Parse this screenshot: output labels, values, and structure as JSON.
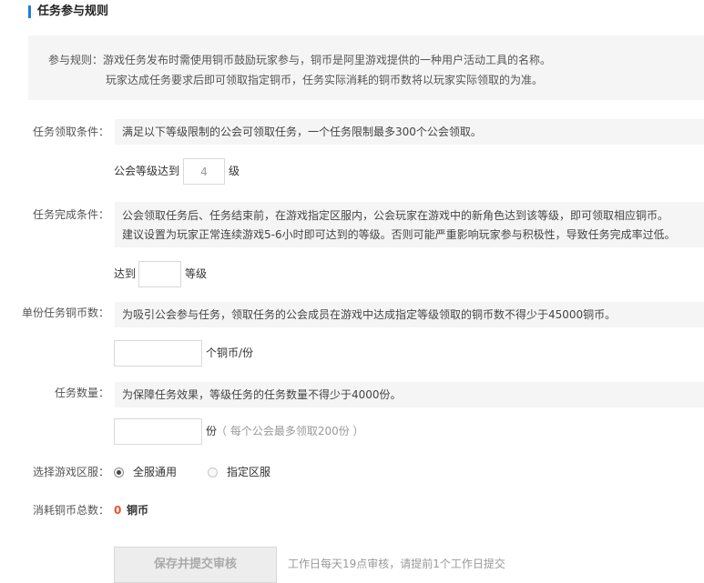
{
  "header": {
    "title": "任务参与规则"
  },
  "rules": {
    "label": "参与规则：",
    "line1": "游戏任务发布时需使用铜币鼓励玩家参与，铜币是阿里游戏提供的一种用户活动工具的名称。",
    "line2": "玩家达成任务要求后即可领取指定铜币，任务实际消耗的铜币数将以玩家实际领取的为准。"
  },
  "claim_condition": {
    "label": "任务领取条件：",
    "hint": "满足以下等级限制的公会可领取任务，一个任务限制最多300个公会领取。",
    "prefix": "公会等级达到",
    "value": "4",
    "suffix": "级"
  },
  "complete_condition": {
    "label": "任务完成条件：",
    "hint_line1": "公会领取任务后、任务结束前，在游戏指定区服内，公会玩家在游戏中的新角色达到该等级，即可领取相应铜币。",
    "hint_line2": "建议设置为玩家正常连续游戏5-6小时即可达到的等级。否则可能严重影响玩家参与积极性，导致任务完成率过低。",
    "prefix": "达到",
    "value": "",
    "suffix": "等级"
  },
  "coins_per_task": {
    "label": "单份任务铜币数：",
    "hint": "为吸引公会参与任务，领取任务的公会成员在游戏中达成指定等级领取的铜币数不得少于45000铜币。",
    "value": "",
    "suffix": "个铜币/份"
  },
  "task_count": {
    "label": "任务数量：",
    "hint": "为保障任务效果，等级任务的任务数量不得少于4000份。",
    "value": "",
    "suffix": "份",
    "note": "（ 每个公会最多领取200份 ）"
  },
  "server": {
    "label": "选择游戏区服：",
    "options": [
      {
        "label": "全服通用",
        "selected": true
      },
      {
        "label": "指定区服",
        "selected": false
      }
    ]
  },
  "total": {
    "label": "消耗铜币总数：",
    "value": "0",
    "unit": "铜币"
  },
  "submit": {
    "label": "保存并提交审核",
    "note": "工作日每天19点审核，请提前1个工作日提交"
  },
  "colors": {
    "accent": "#1e7fe0",
    "total_value": "#e8542b"
  }
}
